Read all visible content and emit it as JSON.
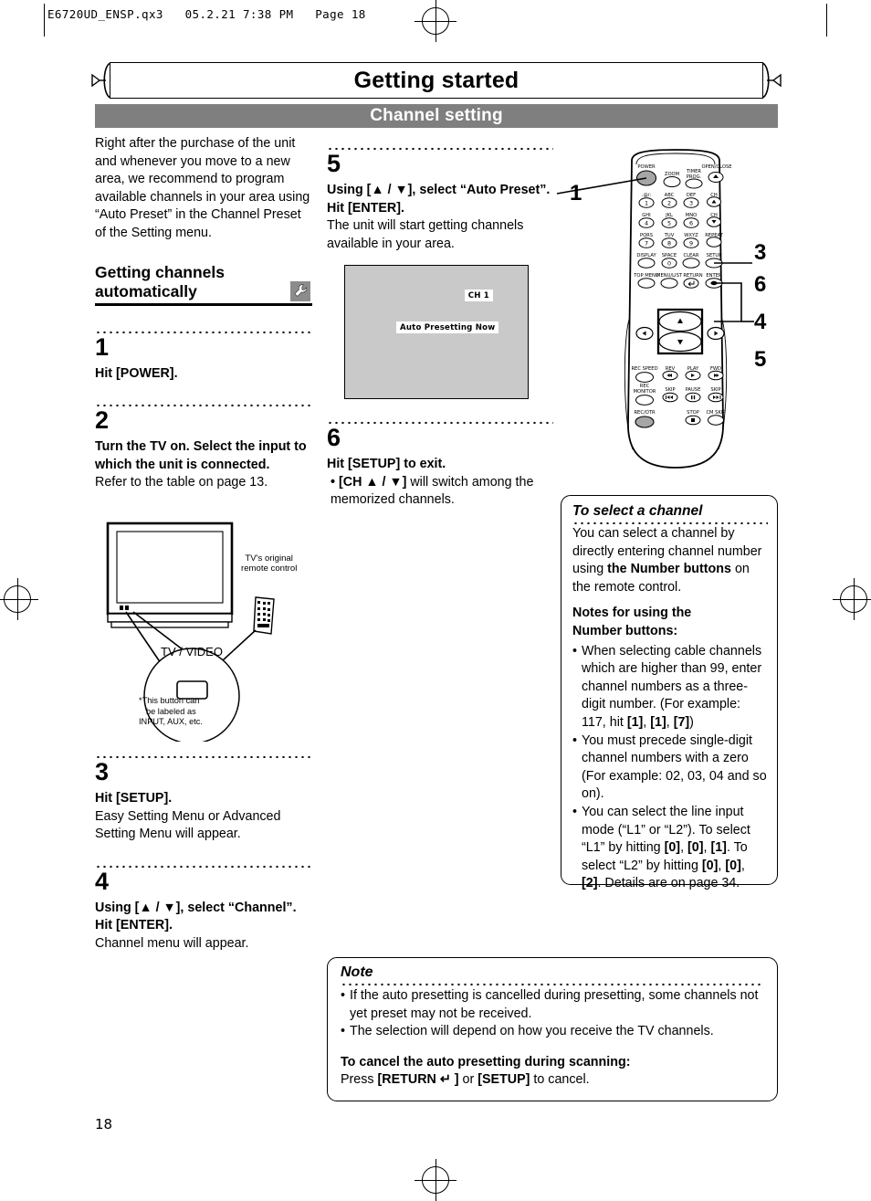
{
  "prepress": {
    "header": "E6720UD_ENSP.qx3   05.2.21 7:38 PM   Page 18"
  },
  "banner": {
    "chapter_title": "Getting started",
    "section_title": "Channel setting"
  },
  "intro": {
    "paragraph": "Right after the purchase of the unit and whenever you move to a new area, we recommend to program available channels in your area using “Auto Preset” in the Channel Preset of the Setting menu.",
    "subheading_line1": "Getting channels",
    "subheading_line2": "automatically",
    "tool_icon": "wrench-icon"
  },
  "steps": [
    {
      "number": "1",
      "bold": "Hit [POWER].",
      "plain": ""
    },
    {
      "number": "2",
      "bold": "Turn the TV on. Select the input to which the unit is connected.",
      "plain": "Refer to the table on page 13."
    },
    {
      "number": "3",
      "bold": "Hit [SETUP].",
      "plain": "Easy Setting Menu or Advanced Setting Menu will appear."
    },
    {
      "number": "4",
      "bold": "Using [▲ / ▼], select “Channel”. Hit [ENTER].",
      "plain": "Channel menu will appear."
    },
    {
      "number": "5",
      "bold": "Using [▲ / ▼], select “Auto Preset”. Hit [ENTER].",
      "plain": "The unit will start getting channels available in your area."
    },
    {
      "number": "6",
      "bold": "Hit [SETUP] to exit.",
      "bullet_bold": "• [CH ▲ / ▼]",
      "bullet_plain": " will switch among the memorized channels."
    }
  ],
  "tv_figure": {
    "remote_caption_line1": "TV's original",
    "remote_caption_line2": "remote control",
    "callout_button_label": "TV / VIDEO",
    "callout_note_line1": "*This button can",
    "callout_note_line2": "be labeled as",
    "callout_note_line3": "INPUT, AUX, etc."
  },
  "osd": {
    "channel_label": "CH 1",
    "status_label": "Auto Presetting Now"
  },
  "select_channel_box": {
    "title": "To select a channel",
    "para_part1": "You can select a channel by directly entering channel number using ",
    "para_bold": "the Number buttons",
    "para_part2": " on the remote control.",
    "notes_heading_line1": "Notes for using the",
    "notes_heading_line2": "Number buttons:",
    "bullets": [
      {
        "segments": [
          {
            "text": "When selecting cable channels which are higher than 99, enter channel numbers as a three-digit number. (For example: 117, hit ",
            "bold": false
          },
          {
            "text": "[1]",
            "bold": true
          },
          {
            "text": ", ",
            "bold": false
          },
          {
            "text": "[1]",
            "bold": true
          },
          {
            "text": ", ",
            "bold": false
          },
          {
            "text": "[7]",
            "bold": true
          },
          {
            "text": ")",
            "bold": false
          }
        ]
      },
      {
        "segments": [
          {
            "text": "You must precede single-digit channel numbers with a zero (For example: 02, 03, 04 and so on).",
            "bold": false
          }
        ]
      },
      {
        "segments": [
          {
            "text": "You can select the line input mode (“L1” or “L2”). To select “L1” by hitting ",
            "bold": false
          },
          {
            "text": "[0]",
            "bold": true
          },
          {
            "text": ", ",
            "bold": false
          },
          {
            "text": "[0]",
            "bold": true
          },
          {
            "text": ", ",
            "bold": false
          },
          {
            "text": "[1]",
            "bold": true
          },
          {
            "text": ". To select “L2” by hitting ",
            "bold": false
          },
          {
            "text": "[0]",
            "bold": true
          },
          {
            "text": ", ",
            "bold": false
          },
          {
            "text": "[0]",
            "bold": true
          },
          {
            "text": ", ",
            "bold": false
          },
          {
            "text": "[2]",
            "bold": true
          },
          {
            "text": ". Details are on page 34.",
            "bold": false
          }
        ]
      }
    ]
  },
  "note_box": {
    "title": "Note",
    "bullets": [
      "If the auto presetting is cancelled during presetting, some channels not yet preset may not be received.",
      "The selection will depend on how you receive the TV channels."
    ],
    "cancel_heading": "To cancel the auto presetting during scanning:",
    "cancel_part1": "Press ",
    "cancel_key1": "[RETURN ↵ ]",
    "cancel_mid": " or ",
    "cancel_key2": "[SETUP]",
    "cancel_part2": " to cancel."
  },
  "remote": {
    "callouts": [
      "1",
      "3",
      "6",
      "4",
      "5"
    ],
    "labels": {
      "power": "POWER",
      "zoom": "ZOOM",
      "timer_prog_line1": "TIMER",
      "timer_prog_line2": "PROG.",
      "open_close": "OPEN/CLOSE",
      "key1_alpha": ".@/:",
      "key2_alpha": "ABC",
      "key3_alpha": "DEF",
      "ch": "CH",
      "key4_alpha": "GHI",
      "key5_alpha": "JKL",
      "key6_alpha": "MNO",
      "key7_alpha": "PQRS",
      "key8_alpha": "TUV",
      "key9_alpha": "WXYZ",
      "repeat": "REPEAT",
      "display": "DISPLAY",
      "space": "SPACE",
      "clear": "CLEAR",
      "setup": "SETUP",
      "top_menu": "TOP MENU",
      "menu_list": "MENU/LIST",
      "return": "RETURN",
      "enter": "ENTER",
      "rec_speed": "REC SPEED",
      "rev": "REV",
      "play": "PLAY",
      "fwd": "FWD",
      "rec_monitor_line1": "REC",
      "rec_monitor_line2": "MONITOR",
      "skip_back": "SKIP",
      "pause": "PAUSE",
      "skip_fwd": "SKIP",
      "rec_otr": "REC/OTR",
      "stop": "STOP",
      "cm_skip": "CM SKIP"
    },
    "number_keys": [
      "1",
      "2",
      "3",
      "4",
      "5",
      "6",
      "7",
      "8",
      "9",
      "0"
    ]
  },
  "footer": {
    "page_number": "18"
  },
  "colors": {
    "section_bar": "#7f7f7f",
    "osd_background": "#c9c9c9",
    "highlight_button": "#a6a6a6",
    "badge": "#8c8c8c"
  }
}
